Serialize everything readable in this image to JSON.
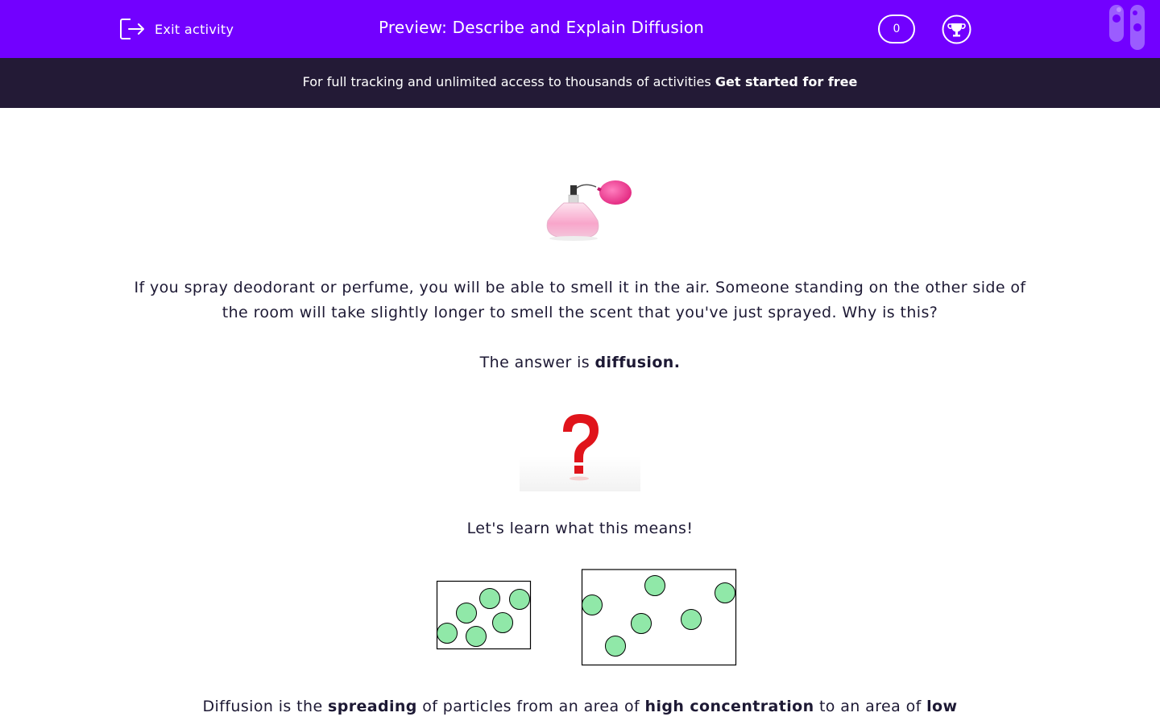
{
  "header": {
    "exit_label": "Exit activity",
    "title": "Preview: Describe and Explain Diffusion",
    "score": "0"
  },
  "banner": {
    "text": "For full tracking and unlimited access to thousands of activities ",
    "cta": "Get started for free"
  },
  "content": {
    "question": "If you spray deodorant or perfume, you will be able to smell it in the air. Someone standing on the other side of the room will take slightly longer to smell the scent that you've just sprayed. Why is this?",
    "answer_prefix": "The answer is ",
    "answer_bold": "diffusion.",
    "learn": "Let's learn what this means!",
    "def_1": "Diffusion is the ",
    "def_b1": "spreading",
    "def_2": " of particles from an area of ",
    "def_b2": "high concentration",
    "def_3": " to an area of ",
    "def_b3": "low"
  },
  "colors": {
    "header_bg": "#7200ff",
    "banner_bg": "#231a36",
    "text": "#1d1934",
    "particle": "#90e8a8"
  },
  "icons": [
    "exit-icon",
    "trophy-icon",
    "logo-icon",
    "perfume-image",
    "question-mark-image",
    "diffusion-diagram"
  ]
}
